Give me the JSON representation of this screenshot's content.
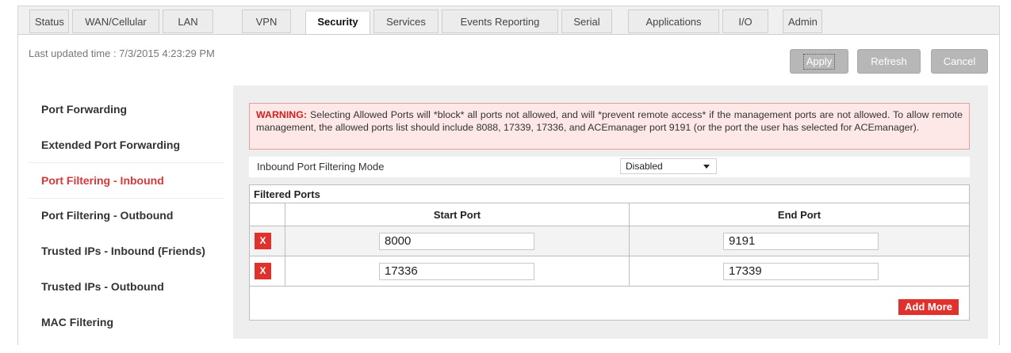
{
  "tabs": [
    {
      "label": "Status",
      "active": false
    },
    {
      "label": "WAN/Cellular",
      "active": false
    },
    {
      "label": "LAN",
      "active": false
    },
    {
      "label": "VPN",
      "active": false
    },
    {
      "label": "Security",
      "active": true
    },
    {
      "label": "Services",
      "active": false
    },
    {
      "label": "Events Reporting",
      "active": false
    },
    {
      "label": "Serial",
      "active": false
    },
    {
      "label": "Applications",
      "active": false
    },
    {
      "label": "I/O",
      "active": false
    },
    {
      "label": "Admin",
      "active": false
    }
  ],
  "header": {
    "last_updated": "Last updated time : 7/3/2015 4:23:29 PM",
    "apply_label": "Apply",
    "refresh_label": "Refresh",
    "cancel_label": "Cancel"
  },
  "sidebar": {
    "items": [
      {
        "label": "Port Forwarding",
        "active": false
      },
      {
        "label": "Extended Port Forwarding",
        "active": false
      },
      {
        "label": "Port Filtering - Inbound",
        "active": true
      },
      {
        "label": "Port Filtering - Outbound",
        "active": false
      },
      {
        "label": "Trusted IPs - Inbound (Friends)",
        "active": false
      },
      {
        "label": "Trusted IPs - Outbound",
        "active": false
      },
      {
        "label": "MAC Filtering",
        "active": false
      }
    ]
  },
  "warning": {
    "prefix": "WARNING:",
    "text": "Selecting Allowed Ports will *block* all ports not allowed, and will *prevent remote access* if the management ports are not allowed. To allow remote management, the allowed ports list should include 8088, 17339, 17336, and ACEmanager port 9191 (or the port the user has selected for ACEmanager)."
  },
  "mode": {
    "label": "Inbound Port Filtering Mode",
    "value": "Disabled"
  },
  "filtered_ports": {
    "title": "Filtered Ports",
    "col_start": "Start Port",
    "col_end": "End Port",
    "delete_label": "X",
    "rows": [
      {
        "start": "8000",
        "end": "9191"
      },
      {
        "start": "17336",
        "end": "17339"
      }
    ],
    "add_more_label": "Add More"
  },
  "colors": {
    "accent_red": "#e0312d",
    "active_sidebar": "#d8383a",
    "button_gray": "#b7b7b7"
  }
}
